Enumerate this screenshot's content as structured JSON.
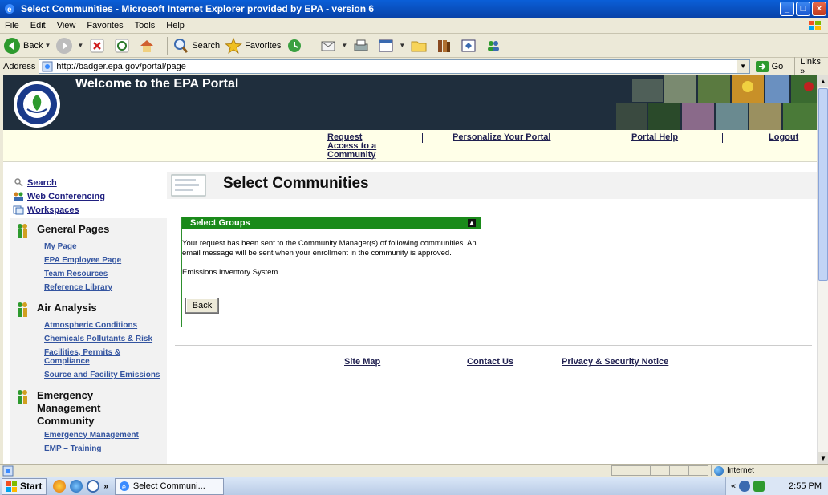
{
  "window": {
    "title": "Select Communities - Microsoft Internet Explorer provided by EPA - version 6"
  },
  "menu": [
    "File",
    "Edit",
    "View",
    "Favorites",
    "Tools",
    "Help"
  ],
  "toolbar": {
    "back_label": "Back",
    "search_label": "Search",
    "favorites_label": "Favorites"
  },
  "address": {
    "label": "Address",
    "url": "http://badger.epa.gov/portal/page",
    "go_label": "Go",
    "links_label": "Links"
  },
  "banner": {
    "welcome": "Welcome to the EPA Portal"
  },
  "nav": {
    "request_line1": "Request",
    "request_line2": "Access to a",
    "request_line3": "Community",
    "personalize": "Personalize Your Portal",
    "help": "Portal Help",
    "logout": "Logout"
  },
  "sidebar": {
    "top_links": [
      "Search",
      "Web Conferencing",
      "Workspaces"
    ],
    "sections": [
      {
        "title": "General Pages",
        "items": [
          "My Page",
          "EPA Employee Page",
          "Team Resources",
          "Reference Library"
        ]
      },
      {
        "title": "Air Analysis",
        "items": [
          "Atmospheric Conditions",
          "Chemicals Pollutants & Risk",
          "Facilities, Permits & Compliance",
          "Source and Facility Emissions"
        ]
      },
      {
        "title_line1": "Emergency",
        "title_line2": "Management",
        "title_line3": "Community",
        "items": [
          "Emergency Management",
          "EMP – Training"
        ]
      }
    ]
  },
  "main": {
    "page_title": "Select Communities",
    "group_box": {
      "title": "Select Groups",
      "message": "Your request has been sent to the Community Manager(s) of following communities. An email message will be sent when your enrollment in the community is approved.",
      "community": "Emissions Inventory System",
      "back_label": "Back"
    }
  },
  "footer": {
    "site_map": "Site Map",
    "contact": "Contact Us",
    "privacy": "Privacy & Security Notice"
  },
  "status": {
    "zone": "Internet"
  },
  "taskbar": {
    "start": "Start",
    "task_label": "Select Communi...",
    "time": "2:55 PM",
    "tray_chevron": "«"
  },
  "colors": {
    "banner_bg": "#1f2e3d",
    "group_header": "#1a8a1a",
    "link": "#202050"
  }
}
